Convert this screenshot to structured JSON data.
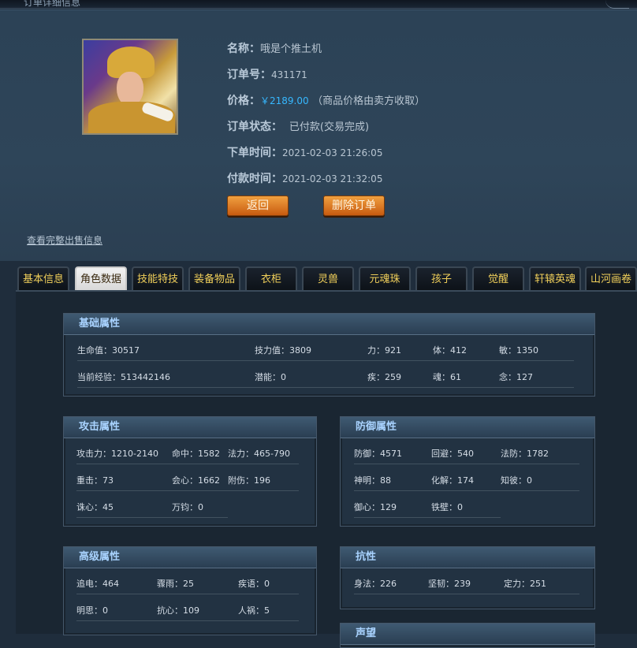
{
  "top_title": "订单详细信息",
  "order": {
    "name_label": "名称：",
    "name_value": "哦是个推土机",
    "order_no_label": "订单号：",
    "order_no_value": "431171",
    "price_label": "价格：",
    "price_value": "￥2189.00",
    "price_note": "（商品价格由卖方收取）",
    "status_label": "订单状态：",
    "status_value": "已付款(交易完成)",
    "order_time_label": "下单时间：",
    "order_time_value": "2021-02-03 21:26:05",
    "pay_time_label": "付款时间：",
    "pay_time_value": "2021-02-03 21:32:05"
  },
  "buttons": {
    "back": "返回",
    "delete": "删除订单"
  },
  "view_full_link": "查看完整出售信息",
  "tabs": [
    "基本信息",
    "角色数据",
    "技能特技",
    "装备物品",
    "衣柜",
    "灵兽",
    "元魂珠",
    "孩子",
    "觉醒",
    "轩辕英魂",
    "山河画卷"
  ],
  "active_tab": "角色数据",
  "panels": {
    "basic": {
      "title": "基础属性",
      "hp": "生命值：30517",
      "sp": "技力值：3809",
      "str": "力：921",
      "con": "体：412",
      "agi": "敏：1350",
      "exp": "当前经验：513442146",
      "potential": "潜能：0",
      "swift": "疾：259",
      "soul": "魂：61",
      "mind": "念：127"
    },
    "attack": {
      "title": "攻击属性",
      "atk": "攻击力：1210-2140",
      "hit": "命中：1582",
      "magic": "法力：465-790",
      "crit": "重击：73",
      "heart": "会心：1662",
      "extra": "附伤：196",
      "zhuxin": "诛心：45",
      "wanjun": "万钧：0"
    },
    "defense": {
      "title": "防御属性",
      "def": "防御：4571",
      "dodge": "回避：540",
      "mdef": "法防：1782",
      "shenming": "神明：88",
      "resolve": "化解：174",
      "zhibi": "知彼：0",
      "yuxin": "御心：129",
      "tiebi": "铁壁：0"
    },
    "advanced": {
      "title": "高级属性",
      "zhuidian": "追电：464",
      "zhouyu": "骤雨：25",
      "jiyu": "疾语：0",
      "mingsi": "明思：0",
      "kangxin": "抗心：109",
      "renhuo": "人祸：5"
    },
    "resist": {
      "title": "抗性",
      "shenfa": "身法：226",
      "jianren": "坚韧：239",
      "dingli": "定力：251"
    },
    "reputation": {
      "title": "声望"
    }
  }
}
